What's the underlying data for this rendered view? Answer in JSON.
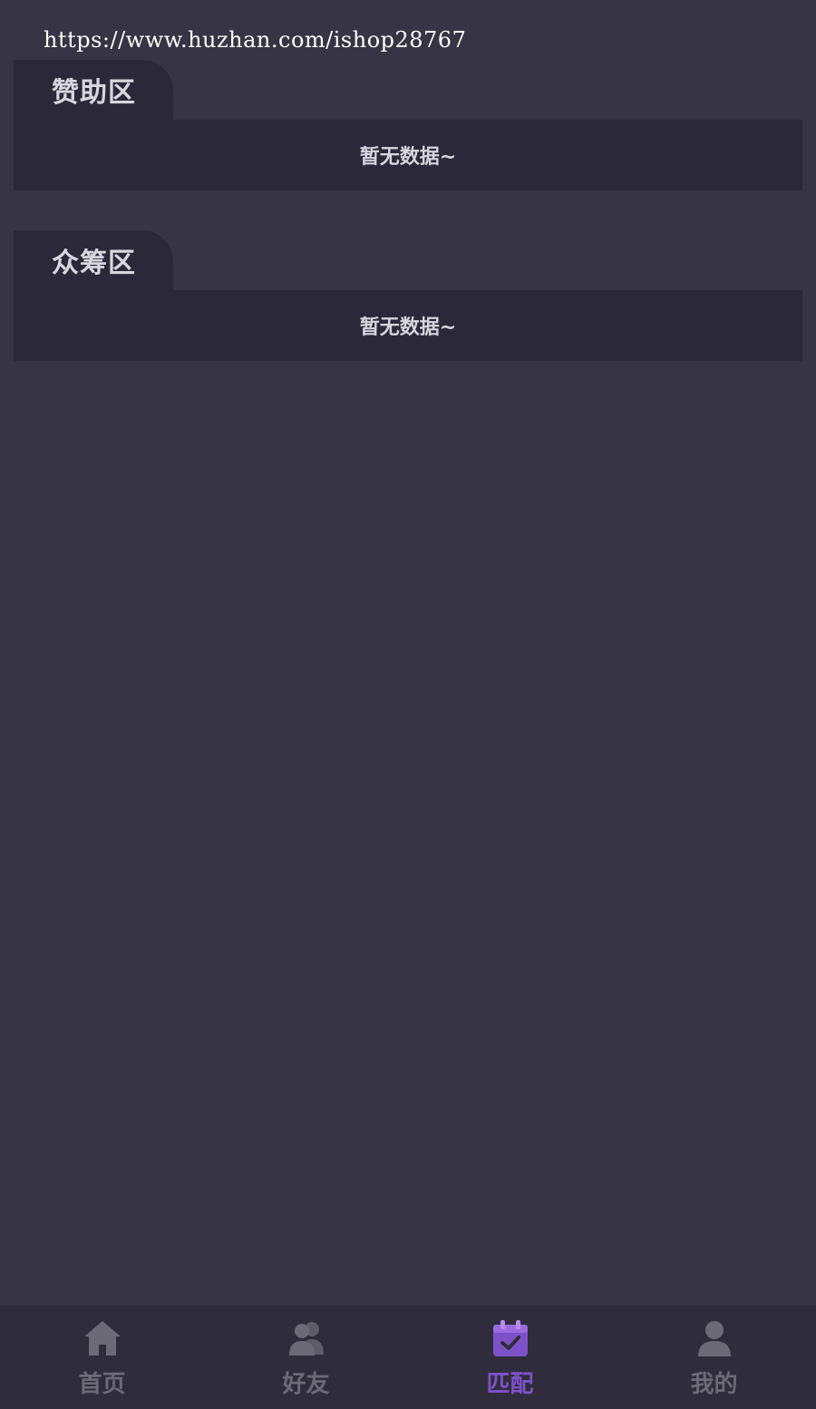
{
  "watermark": "https://www.huzhan.com/ishop28767",
  "sections": [
    {
      "title": "赞助区",
      "empty_text": "暂无数据~"
    },
    {
      "title": "众筹区",
      "empty_text": "暂无数据~"
    }
  ],
  "bottom_nav": {
    "items": [
      {
        "label": "首页",
        "icon": "home-icon"
      },
      {
        "label": "好友",
        "icon": "friends-icon"
      },
      {
        "label": "匹配",
        "icon": "calendar-check-icon"
      },
      {
        "label": "我的",
        "icon": "user-icon"
      }
    ],
    "active_index": 2
  },
  "colors": {
    "background": "#373445",
    "card": "#2b2839",
    "nav_bar": "#2f2c3c",
    "inactive": "#6c6a76",
    "active": "#7d52c8"
  }
}
